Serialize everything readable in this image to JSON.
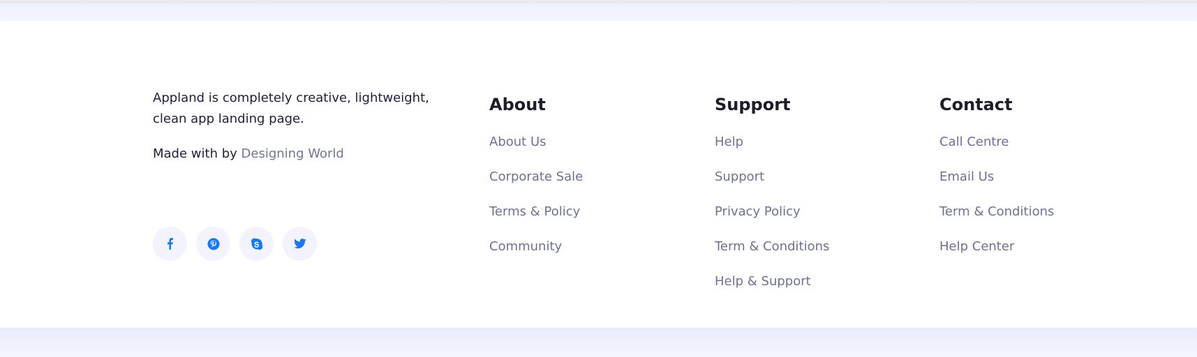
{
  "brand": {
    "description": "Appland is completely creative, lightweight, clean app landing page.",
    "made_with_prefix": "Made with ",
    "made_with_by": " by ",
    "author_link": "Designing World"
  },
  "social": [
    {
      "icon": "facebook-icon"
    },
    {
      "icon": "pinterest-icon"
    },
    {
      "icon": "skype-icon"
    },
    {
      "icon": "twitter-icon"
    }
  ],
  "columns": {
    "about": {
      "title": "About",
      "links": [
        "About Us",
        "Corporate Sale",
        "Terms & Policy",
        "Community"
      ]
    },
    "support": {
      "title": "Support",
      "links": [
        "Help",
        "Support",
        "Privacy Policy",
        "Term & Conditions",
        "Help & Support"
      ]
    },
    "contact": {
      "title": "Contact",
      "links": [
        "Call Centre",
        "Email Us",
        "Term & Conditions",
        "Help Center"
      ]
    }
  },
  "colors": {
    "icon_blue": "#1877f2",
    "link_gray": "#6f7190",
    "heading": "#1d1d2a"
  }
}
